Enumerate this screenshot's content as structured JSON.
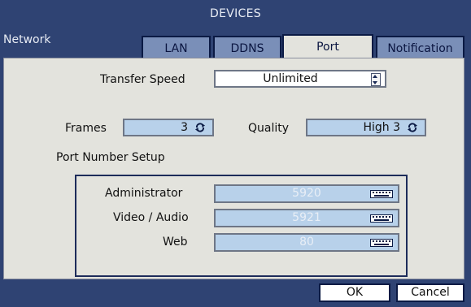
{
  "window": {
    "title": "DEVICES"
  },
  "section": {
    "label": "Network"
  },
  "tabs": [
    {
      "label": "LAN",
      "active": false
    },
    {
      "label": "DDNS",
      "active": false
    },
    {
      "label": "Port",
      "active": true
    },
    {
      "label": "Notification",
      "active": false
    }
  ],
  "transfer_speed": {
    "label": "Transfer Speed",
    "value": "Unlimited",
    "icon": "spin-updown-icon"
  },
  "frames": {
    "label": "Frames",
    "value": "3",
    "icon": "cycle-icon"
  },
  "quality": {
    "label": "Quality",
    "value": "High 3",
    "icon": "cycle-icon"
  },
  "port_setup": {
    "title": "Port Number Setup",
    "rows": [
      {
        "label": "Administrator",
        "value": "5920",
        "icon": "keyboard-icon"
      },
      {
        "label": "Video / Audio",
        "value": "5921",
        "icon": "keyboard-icon"
      },
      {
        "label": "Web",
        "value": "80",
        "icon": "keyboard-icon"
      }
    ]
  },
  "buttons": {
    "ok": "OK",
    "cancel": "Cancel"
  },
  "colors": {
    "frame": "#2f4373",
    "panel": "#e3e3dd",
    "tab_inactive": "#7a8fb8",
    "field_blue": "#b8d1ea",
    "border_dark": "#0b1a44"
  }
}
